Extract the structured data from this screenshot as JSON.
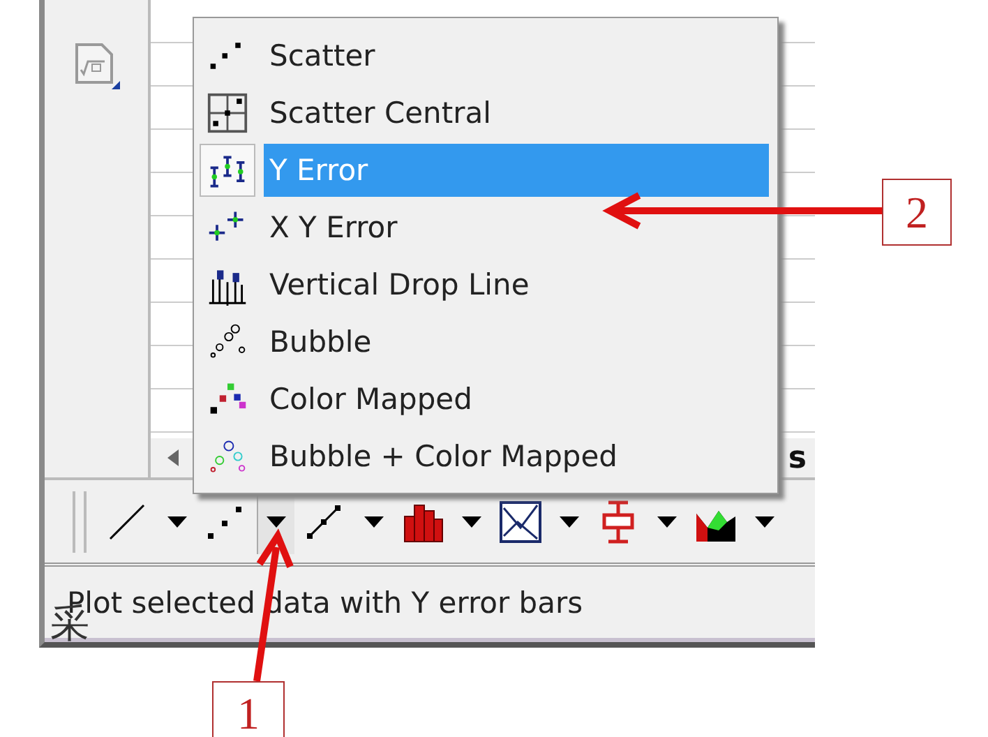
{
  "menu": {
    "items": [
      {
        "label": "Scatter",
        "kind": "scatter",
        "selected": false
      },
      {
        "label": "Scatter Central",
        "kind": "central",
        "selected": false
      },
      {
        "label": "Y Error",
        "kind": "yerror",
        "selected": true
      },
      {
        "label": "X Y Error",
        "kind": "xyerror",
        "selected": false
      },
      {
        "label": "Vertical Drop Line",
        "kind": "drop",
        "selected": false
      },
      {
        "label": "Bubble",
        "kind": "bubble",
        "selected": false
      },
      {
        "label": "Color Mapped",
        "kind": "colormap",
        "selected": false
      },
      {
        "label": "Bubble + Color Mapped",
        "kind": "bubblecolor",
        "selected": false
      }
    ]
  },
  "sheet": {
    "partial_text": "s"
  },
  "toolbar": {
    "buttons": [
      {
        "kind": "line",
        "selected": false
      },
      {
        "kind": "scatter",
        "selected": true
      },
      {
        "kind": "linesymbol",
        "selected": false
      },
      {
        "kind": "column",
        "selected": false
      },
      {
        "kind": "box",
        "selected": false
      },
      {
        "kind": "error",
        "selected": false
      },
      {
        "kind": "area",
        "selected": false
      }
    ]
  },
  "status_bar": {
    "text": "Plot selected data with Y error bars"
  },
  "overlay_char": "采",
  "annotations": [
    {
      "label": "1",
      "kind": "up"
    },
    {
      "label": "2",
      "kind": "left"
    }
  ]
}
